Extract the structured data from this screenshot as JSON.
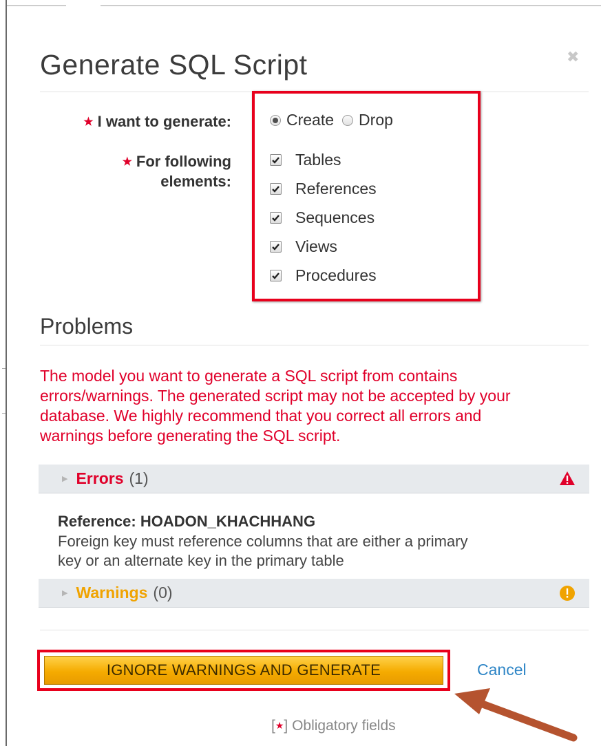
{
  "dialog": {
    "title": "Generate SQL Script",
    "close_symbol": "✖"
  },
  "form": {
    "generate_label": "I want to generate:",
    "elements_label_line1": "For following",
    "elements_label_line2": "elements:",
    "required_marker": "★",
    "mode_options": [
      {
        "label": "Create",
        "selected": true
      },
      {
        "label": "Drop",
        "selected": false
      }
    ],
    "elements": [
      {
        "label": "Tables",
        "checked": true
      },
      {
        "label": "References",
        "checked": true
      },
      {
        "label": "Sequences",
        "checked": true
      },
      {
        "label": "Views",
        "checked": true
      },
      {
        "label": "Procedures",
        "checked": true
      }
    ]
  },
  "problems": {
    "heading": "Problems",
    "message_lines": [
      "The model you want to generate a SQL script from contains",
      "errors/warnings. The generated script may not be accepted by your",
      "database. We highly recommend that you correct all errors and",
      "warnings before generating the SQL script."
    ],
    "errors": {
      "label": "Errors",
      "count": "(1)",
      "icon": "warning-triangle-icon"
    },
    "error_detail": {
      "title": "Reference: HOADON_KHACHHANG",
      "text_line1": "Foreign key must reference columns that are either a primary",
      "text_line2": "key or an alternate key in the primary table"
    },
    "warnings": {
      "label": "Warnings",
      "count": "(0)",
      "icon": "exclamation-circle-icon"
    }
  },
  "actions": {
    "generate_label": "IGNORE WARNINGS AND GENERATE",
    "cancel_label": "Cancel"
  },
  "footer": {
    "bracket_open": "[",
    "star": "★",
    "bracket_close": "]",
    "text": " Obligatory fields"
  },
  "colors": {
    "required_red": "#e0002a",
    "highlight_red": "#e8001c",
    "button_orange": "#f5ab00",
    "link_blue": "#2f86c6",
    "warning_orange": "#f0a300",
    "arrow_brown": "#b5532f"
  }
}
